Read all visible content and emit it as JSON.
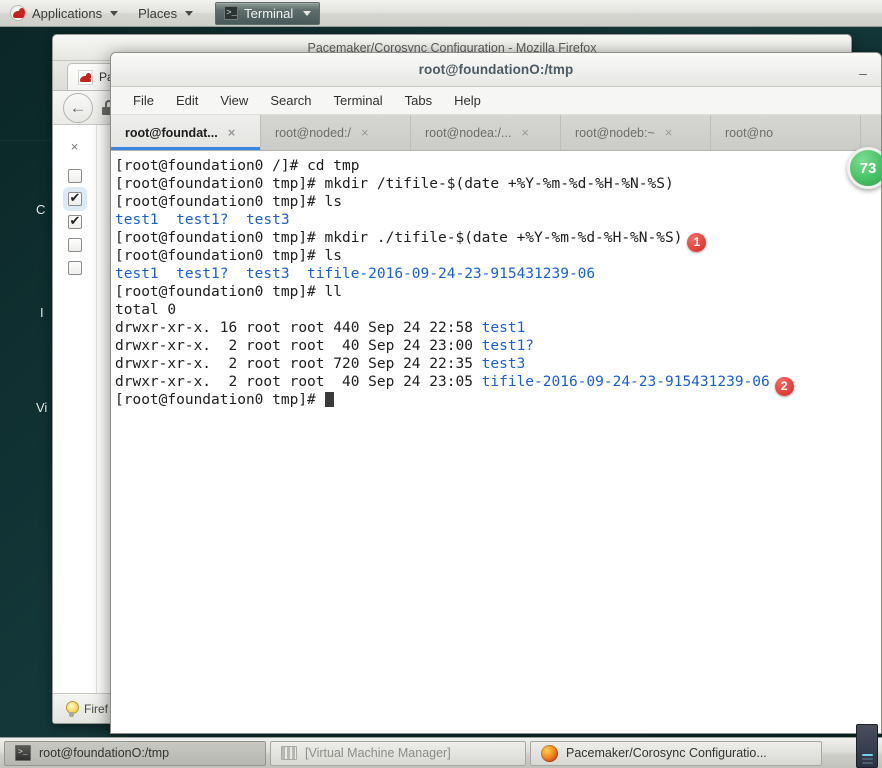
{
  "top_panel": {
    "logo_icon": "redhat-logo-icon",
    "applications_label": "Applications",
    "places_label": "Places",
    "terminal_window_label": "Terminal",
    "caret_icon": "chevron-down-icon"
  },
  "firefox_window": {
    "title": "Pacemaker/Corosync Configuration - Mozilla Firefox",
    "tab_label": "Pacemaker/Corosync Configuratio...",
    "favicon": "redhat-favicon-icon",
    "back_icon": "back-arrow-icon",
    "lock_icon": "lock-icon",
    "close_icon": "close-icon",
    "sidebar_left_texts": [
      "C",
      "I",
      "Vi"
    ],
    "checkboxes": [
      {
        "checked": false,
        "selected": false
      },
      {
        "checked": true,
        "selected": true
      },
      {
        "checked": true,
        "selected": false
      },
      {
        "checked": false,
        "selected": false
      },
      {
        "checked": false,
        "selected": false
      }
    ],
    "statusbar": {
      "bulb_icon": "lightbulb-icon",
      "text": "Firef"
    }
  },
  "terminal_window": {
    "title": "root@foundationO:/tmp",
    "minimize_label": "–",
    "minimize_icon": "minimize-icon",
    "menu_items": [
      "File",
      "Edit",
      "View",
      "Search",
      "Terminal",
      "Tabs",
      "Help"
    ],
    "tabs": [
      {
        "label": "root@foundat...",
        "active": true,
        "close_icon": "close-icon",
        "close_label": "×"
      },
      {
        "label": "root@noded:/",
        "active": false,
        "close_icon": "close-icon",
        "close_label": "×"
      },
      {
        "label": "root@nodea:/...",
        "active": false,
        "close_icon": "close-icon",
        "close_label": "×"
      },
      {
        "label": "root@nodeb:~",
        "active": false,
        "close_icon": "close-icon",
        "close_label": "×"
      },
      {
        "label": "root@no",
        "active": false,
        "close_icon": "close-icon",
        "close_label": "×"
      }
    ],
    "green_badge": "73",
    "screen_lines": [
      {
        "id": "l1",
        "prompt": "[root@foundation0 /]# ",
        "command": "cd tmp"
      },
      {
        "id": "l2",
        "prompt": "[root@foundation0 tmp]# ",
        "command": "mkdir /tifile-$(date +%Y-%m-%d-%H-%N-%S)"
      },
      {
        "id": "l3",
        "prompt": "[root@foundation0 tmp]# ",
        "command": "ls"
      },
      {
        "id": "l4",
        "output_blue": "test1  test1?  test3"
      },
      {
        "id": "l5",
        "prompt": "[root@foundation0 tmp]# ",
        "command": "mkdir ./tifile-$(date +%Y-%m-%d-%H-%N-%S)",
        "badge": "1"
      },
      {
        "id": "l6",
        "prompt": "[root@foundation0 tmp]# ",
        "command": "ls"
      },
      {
        "id": "l7",
        "output_blue": "test1  test1?  test3  tifile-2016-09-24-23-915431239-06"
      },
      {
        "id": "l8",
        "prompt": "[root@foundation0 tmp]# ",
        "command": "ll"
      },
      {
        "id": "l9",
        "output": "total 0"
      },
      {
        "id": "l10",
        "output": "drwxr-xr-x. 16 root root 440 Sep 24 22:58 ",
        "name_blue": "test1"
      },
      {
        "id": "l11",
        "output": "drwxr-xr-x.  2 root root  40 Sep 24 23:00 ",
        "name_blue": "test1?"
      },
      {
        "id": "l12",
        "output": "drwxr-xr-x.  2 root root 720 Sep 24 22:35 ",
        "name_blue": "test3"
      },
      {
        "id": "l13",
        "output": "drwxr-xr-x.  2 root root  40 Sep 24 23:05 ",
        "name_blue": "tifile-2016-09-24-23-915431239-06",
        "badge": "2"
      },
      {
        "id": "l14",
        "prompt": "[root@foundation0 tmp]# ",
        "cursor": true
      }
    ]
  },
  "bottom_panel": {
    "tasks": [
      {
        "label": "root@foundationO:/tmp",
        "icon": "terminal-icon",
        "active": true
      },
      {
        "label": "[Virtual Machine Manager]",
        "icon": "vmm-icon",
        "active": false
      },
      {
        "label": "Pacemaker/Corosync Configuratio...",
        "icon": "firefox-icon",
        "active": false
      }
    ],
    "workspace_switcher_icon": "workspace-switcher-icon"
  },
  "colors": {
    "desktop": "#0f2b2b",
    "terminal_blue": "#1a5fd4",
    "badge_red": "#e8453c",
    "badge_green": "#4cc568",
    "tab_accent": "#3b85e0"
  }
}
